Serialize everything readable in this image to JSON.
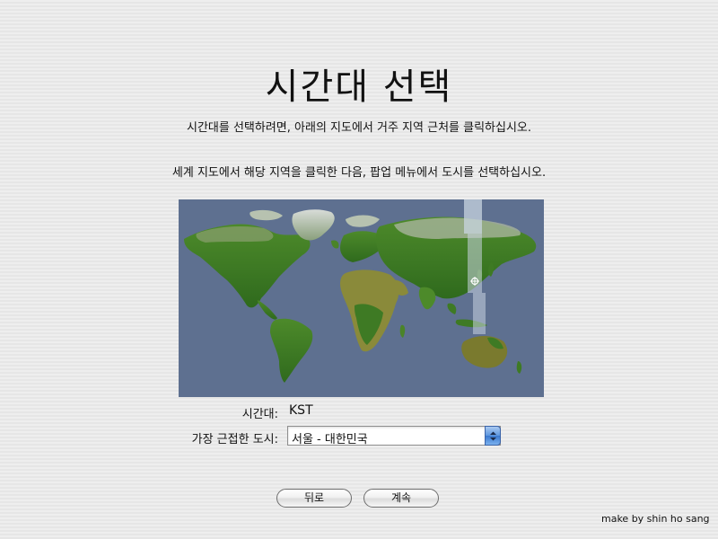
{
  "page": {
    "title": "시간대 선택",
    "instruction_1": "시간대를 선택하려면, 아래의 지도에서 거주 지역 근처를 클릭하십시오.",
    "instruction_2": "세계 지도에서 해당 지역을 클릭한 다음, 팝업 메뉴에서 도시를 선택하십시오."
  },
  "map": {
    "ocean_color": "#5e7090",
    "land_color": "#3f7a26",
    "highlight_color": "#c8d4e0"
  },
  "timezone": {
    "label": "시간대:",
    "value": "KST"
  },
  "city": {
    "label": "가장 근접한 도시:",
    "selected": "서울 - 대한민국",
    "arrow_icon": "double-chevron-icon"
  },
  "buttons": {
    "back": "뒤로",
    "continue": "계속"
  },
  "credit": "make by shin ho sang"
}
